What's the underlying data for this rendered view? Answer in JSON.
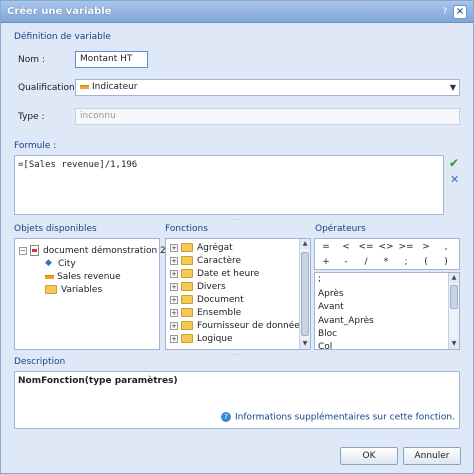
{
  "window": {
    "title": "Créer une variable",
    "help_icon": "?",
    "close_icon": "×"
  },
  "definition": {
    "section_title": "Définition de variable",
    "name_label": "Nom :",
    "name_value": "Montant HT",
    "qualification_label": "Qualification :",
    "qualification_value": "Indicateur",
    "type_label": "Type :",
    "type_value": "inconnu"
  },
  "formula": {
    "section_title": "Formule :",
    "value": "=[Sales revenue]/1,196",
    "validate_icon": "✔",
    "cancel_icon": "✕"
  },
  "objects": {
    "section_title": "Objets disponibles",
    "root": "document démonstration 2",
    "items": [
      "City",
      "Sales revenue",
      "Variables"
    ]
  },
  "functions": {
    "section_title": "Fonctions",
    "items": [
      "Agrégat",
      "Caractère",
      "Date et heure",
      "Divers",
      "Document",
      "Ensemble",
      "Fournisseur de données",
      "Logique"
    ]
  },
  "operators": {
    "section_title": "Opérateurs",
    "row1": [
      "=",
      "<",
      "<=",
      "<>",
      ">=",
      ">",
      ","
    ],
    "row2": [
      "+",
      "-",
      "/",
      "*",
      ";",
      "(",
      ")"
    ],
    "list": [
      ";",
      "Après",
      "Avant",
      "Avant_Après",
      "Bloc",
      "Col"
    ]
  },
  "description": {
    "section_title": "Description",
    "signature": "NomFonction(type paramètres)",
    "more_info": "Informations supplémentaires sur cette fonction."
  },
  "buttons": {
    "ok": "OK",
    "cancel": "Annuler"
  }
}
